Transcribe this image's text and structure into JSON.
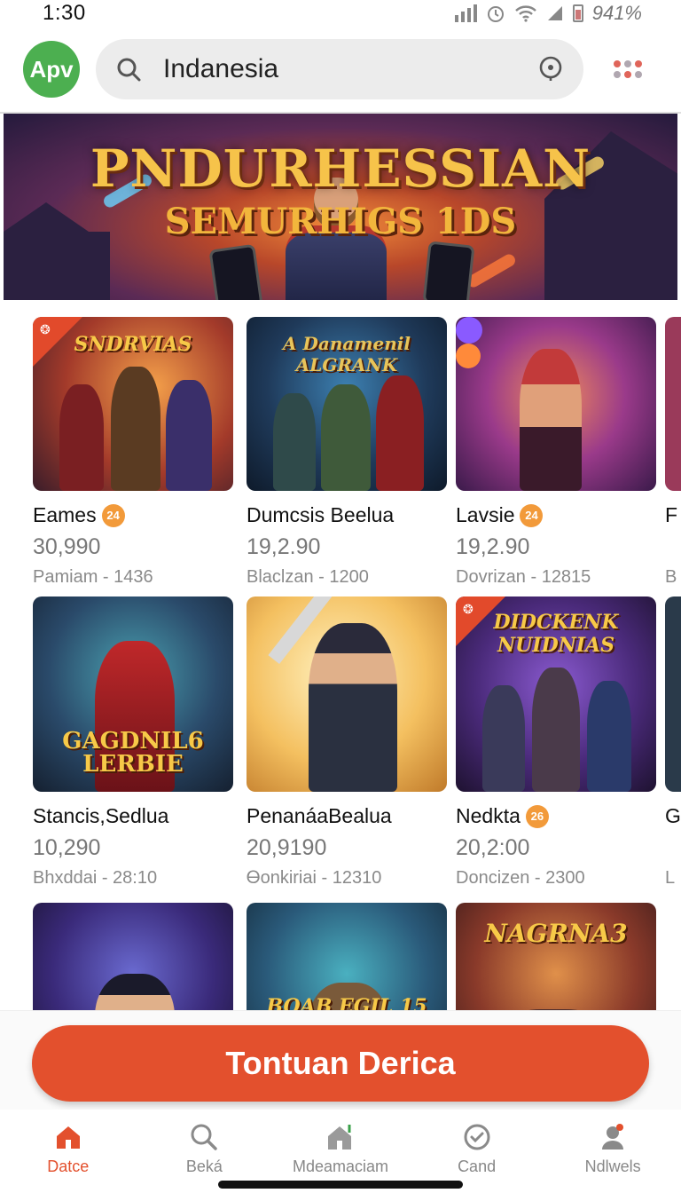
{
  "status_bar": {
    "time": "1:30",
    "battery": "941%"
  },
  "header": {
    "avatar_label": "Apv",
    "search_value": "Indanesia"
  },
  "banner": {
    "title": "PNDURHESSIAN",
    "subtitle": "SEMURHIGS 1DS"
  },
  "games": [
    {
      "thumb_title": "SNDRVIAS",
      "title": "Eames",
      "badge": "24",
      "price": "30,990",
      "meta": "Pamiam - 1436",
      "corner_badge": true
    },
    {
      "thumb_title": "A Danamenil ALGRANK",
      "title": "Dumcsis Beelua",
      "badge": "",
      "price": "19,2.90",
      "meta": "Blaclzan - 1200",
      "corner_badge": false
    },
    {
      "thumb_title": "",
      "title": "Lavsie",
      "badge": "24",
      "price": "19,2.90",
      "meta": "Dovrizan - 12815",
      "corner_badge": false
    },
    {
      "thumb_title": "GAGDNIL6 LERBIE",
      "title": "Stancis,Sedlua",
      "badge": "",
      "price": "10,290",
      "meta": "Bhxddai - 28:10",
      "corner_badge": false
    },
    {
      "thumb_title": "",
      "title": "PenanáaBealua",
      "badge": "",
      "price": "20,9190",
      "meta": "Ꮎonkiriai - 12310",
      "corner_badge": false
    },
    {
      "thumb_title": "DIDCKENK NUIDNIAS",
      "title": "Nedkta",
      "badge": "26",
      "price": "20,2:00",
      "meta": "Doncizen - 2300",
      "corner_badge": true
    },
    {
      "thumb_title": "",
      "title": "",
      "badge": "",
      "price": "",
      "meta": "",
      "corner_badge": false
    },
    {
      "thumb_title": "BOAB EGIL 15",
      "title": "",
      "badge": "",
      "price": "",
      "meta": "",
      "corner_badge": false
    },
    {
      "thumb_title": "NAGRNA3",
      "title": "",
      "badge": "",
      "price": "",
      "meta": "",
      "corner_badge": false
    }
  ],
  "partial_column": [
    {
      "title": "F",
      "meta": "B"
    },
    {
      "title": "G",
      "meta": "L"
    }
  ],
  "cta": {
    "label": "Tontuan Derica"
  },
  "bottom_nav": [
    {
      "label": "Datce",
      "icon": "home-icon",
      "active": true
    },
    {
      "label": "Beká",
      "icon": "search-icon",
      "active": false
    },
    {
      "label": "Mdeamaciam",
      "icon": "store-icon",
      "active": false
    },
    {
      "label": "Cand",
      "icon": "clock-check-icon",
      "active": false
    },
    {
      "label": "Ndlwels",
      "icon": "profile-icon",
      "active": false
    }
  ],
  "colors": {
    "accent": "#e3502d",
    "avatar": "#4caf50",
    "badge": "#f29a3a"
  }
}
